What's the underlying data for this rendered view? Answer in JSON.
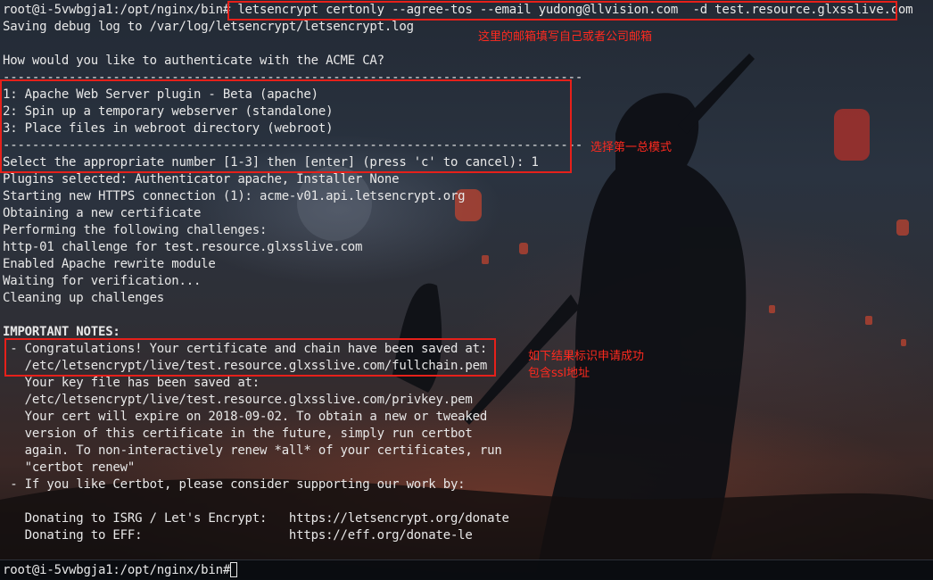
{
  "terminal": {
    "lines": [
      "root@i-5vwbgja1:/opt/nginx/bin# letsencrypt certonly --agree-tos --email yudong@llvision.com  -d test.resource.glxsslive.com",
      "Saving debug log to /var/log/letsencrypt/letsencrypt.log",
      "",
      "How would you like to authenticate with the ACME CA?",
      "-------------------------------------------------------------------------------",
      "1: Apache Web Server plugin - Beta (apache)",
      "2: Spin up a temporary webserver (standalone)",
      "3: Place files in webroot directory (webroot)",
      "-------------------------------------------------------------------------------",
      "Select the appropriate number [1-3] then [enter] (press 'c' to cancel): 1",
      "Plugins selected: Authenticator apache, Installer None",
      "Starting new HTTPS connection (1): acme-v01.api.letsencrypt.org",
      "Obtaining a new certificate",
      "Performing the following challenges:",
      "http-01 challenge for test.resource.glxsslive.com",
      "Enabled Apache rewrite module",
      "Waiting for verification...",
      "Cleaning up challenges",
      "",
      "IMPORTANT NOTES:",
      " - Congratulations! Your certificate and chain have been saved at:",
      "   /etc/letsencrypt/live/test.resource.glxsslive.com/fullchain.pem",
      "   Your key file has been saved at:",
      "   /etc/letsencrypt/live/test.resource.glxsslive.com/privkey.pem",
      "   Your cert will expire on 2018-09-02. To obtain a new or tweaked",
      "   version of this certificate in the future, simply run certbot",
      "   again. To non-interactively renew *all* of your certificates, run",
      "   \"certbot renew\"",
      " - If you like Certbot, please consider supporting our work by:",
      "",
      "   Donating to ISRG / Let's Encrypt:   https://letsencrypt.org/donate",
      "   Donating to EFF:                    https://eff.org/donate-le"
    ],
    "prompt": "root@i-5vwbgja1:/opt/nginx/bin# "
  },
  "annotations": {
    "email_note": "这里的邮箱填写自己或者公司邮箱",
    "mode_note": "选择第一总模式",
    "success_note_line1": "如下结果标识申请成功",
    "success_note_line2": "包含ssl地址"
  },
  "colors": {
    "annotation_red": "#ff2a1f",
    "box_red": "#e6201a",
    "terminal_text": "#e8e8e8"
  }
}
